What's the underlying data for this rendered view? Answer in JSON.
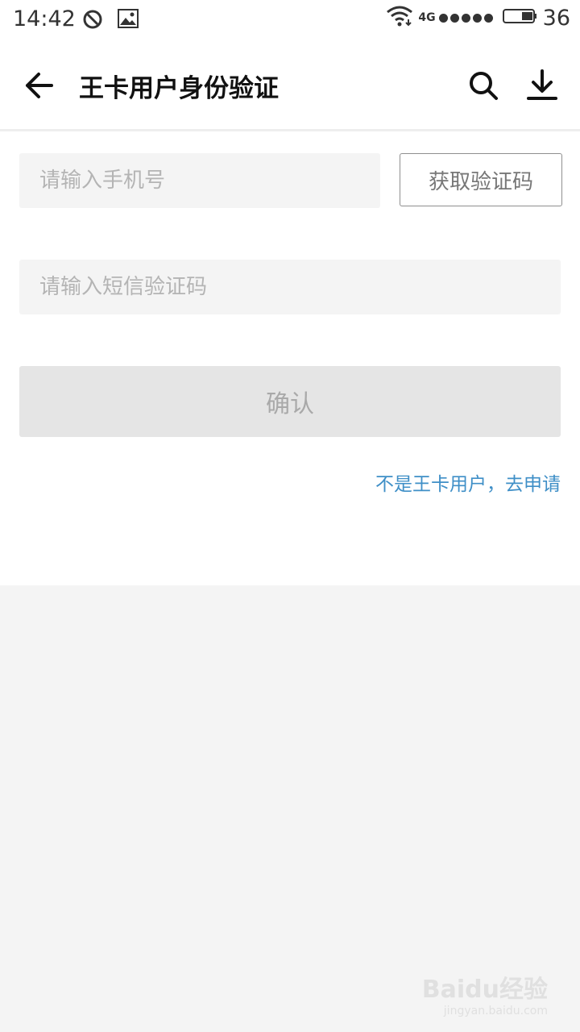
{
  "status_bar": {
    "time": "14:42",
    "network": "4G",
    "battery_level": "36",
    "icons": [
      "do-not-disturb-icon",
      "gallery-icon",
      "wifi-icon",
      "signal-dots-icon",
      "battery-icon"
    ]
  },
  "app_bar": {
    "title": "王卡用户身份验证",
    "icons": [
      "back-arrow-icon",
      "search-icon",
      "download-icon"
    ]
  },
  "form": {
    "phone_placeholder": "请输入手机号",
    "phone_value": "",
    "get_code_label": "获取验证码",
    "sms_placeholder": "请输入短信验证码",
    "sms_value": "",
    "confirm_label": "确认",
    "apply_link": "不是王卡用户，去申请"
  },
  "watermark": {
    "brand": "Baidu经验",
    "url": "jingyan.baidu.com"
  },
  "colors": {
    "link": "#3f8fc7",
    "input_bg": "#f4f4f4",
    "disabled_button_bg": "#e5e5e5"
  }
}
